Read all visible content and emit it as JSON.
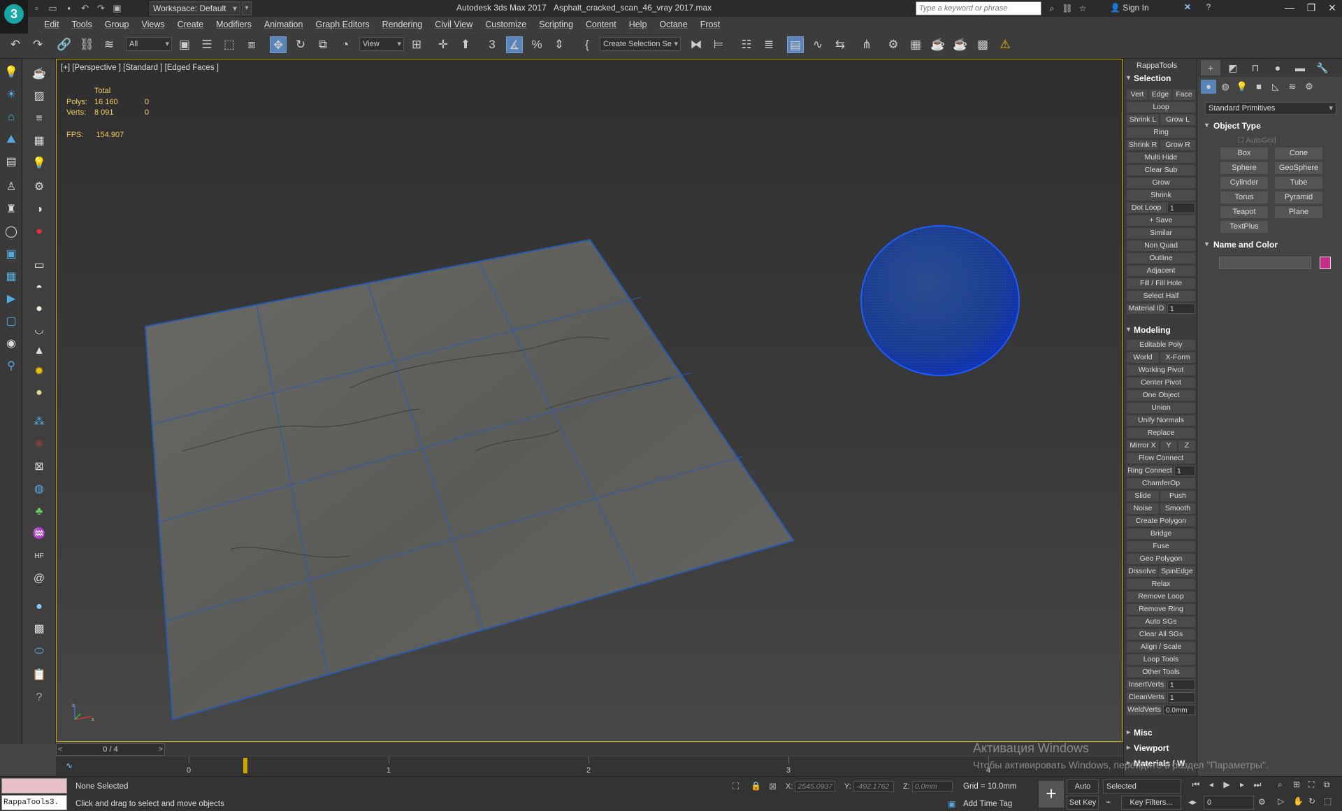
{
  "titlebar": {
    "workspace": "Workspace: Default",
    "app_title": "Autodesk 3ds Max 2017",
    "file_title": "Asphalt_cracked_scan_46_vray 2017.max",
    "search_placeholder": "Type a keyword or phrase",
    "sign_in": "Sign In"
  },
  "menu": [
    "Edit",
    "Tools",
    "Group",
    "Views",
    "Create",
    "Modifiers",
    "Animation",
    "Graph Editors",
    "Rendering",
    "Civil View",
    "Customize",
    "Scripting",
    "Content",
    "Help",
    "Octane",
    "Frost"
  ],
  "toolbar": {
    "filter": "All",
    "ref_coord": "View",
    "selection_set": "Create Selection Se"
  },
  "viewport": {
    "label": "[+] [Perspective ] [Standard ] [Edged Faces ]",
    "stats_header": "Total",
    "polys_label": "Polys:",
    "polys_total": "16 160",
    "polys_sel": "0",
    "verts_label": "Verts:",
    "verts_total": "8 091",
    "verts_sel": "0",
    "fps_label": "FPS:",
    "fps_value": "154.907"
  },
  "timeline": {
    "frame": "0 / 4",
    "ticks": [
      "0",
      "1",
      "2",
      "3",
      "4"
    ]
  },
  "status": {
    "maxscript": "RappaTools3.",
    "selection": "None Selected",
    "prompt": "Click and drag to select and move objects",
    "x_label": "X:",
    "x_value": "2545.0937",
    "y_label": "Y:",
    "y_value": "-492.1762",
    "z_label": "Z:",
    "z_value": "0.0mm",
    "grid": "Grid = 10.0mm",
    "add_time_tag": "Add Time Tag",
    "auto_key": "Auto Key",
    "set_key": "Set Key",
    "key_mode": "Selected",
    "key_filters": "Key Filters...",
    "frame_field": "0"
  },
  "watermark": {
    "line1": "Активация Windows",
    "line2": "Чтобы активировать Windows, перейдите в раздел \"Параметры\"."
  },
  "rappa": {
    "title": "RappaTools",
    "selection_header": "Selection",
    "selection_buttons": [
      "Vert",
      "Edge",
      "Face",
      "Loop",
      "Shrink L",
      "Grow L",
      "Ring",
      "Shrink R",
      "Grow R",
      "Multi Hide",
      "Clear Sub",
      "Grow",
      "Shrink",
      "Dot Loop",
      "+ Save",
      "Similar",
      "Non Quad",
      "Outline",
      "Adjacent",
      "Fill / Fill Hole",
      "Select Half",
      "Material ID"
    ],
    "dot_loop_value": "1",
    "material_id_value": "1",
    "modeling_header": "Modeling",
    "modeling_buttons": [
      "Editable Poly",
      "World",
      "X-Form",
      "Working Pivot",
      "Center Pivot",
      "One Object",
      "Union",
      "Unify Normals",
      "Replace",
      "Mirror X",
      "Y",
      "Z",
      "Flow Connect",
      "Ring Connect",
      "ChamferOp",
      "Slide",
      "Push",
      "Noise",
      "Smooth",
      "Create Polygon",
      "Bridge",
      "Fuse",
      "Geo Polygon",
      "Dissolve",
      "SpinEdge",
      "Relax",
      "Remove Loop",
      "Remove Ring",
      "Auto SGs",
      "Clear All SGs",
      "Align / Scale",
      "Loop Tools",
      "Other Tools",
      "InsertVerts",
      "CleanVerts",
      "WeldVerts"
    ],
    "ring_connect_value": "1",
    "insert_verts_value": "1",
    "clean_verts_value": "1",
    "weld_verts_value": "0.0mm",
    "misc_header": "Misc",
    "viewport_header": "Viewport",
    "materials_header": "Materials / W"
  },
  "command": {
    "category": "Standard Primitives",
    "object_type": "Object Type",
    "autogrid": "AutoGrid",
    "primitives": [
      "Box",
      "Cone",
      "Sphere",
      "GeoSphere",
      "Cylinder",
      "Tube",
      "Torus",
      "Pyramid",
      "Teapot",
      "Plane",
      "TextPlus"
    ],
    "name_and_color": "Name and Color",
    "object_color": "#c52c8a"
  },
  "colors": {
    "accent": "#5a83b8",
    "viewport_border": "#c9a800",
    "stats": "#f0d060"
  }
}
